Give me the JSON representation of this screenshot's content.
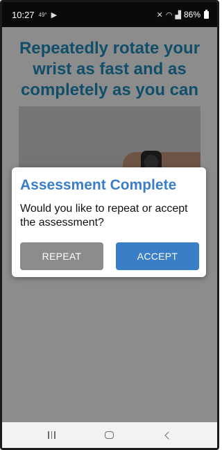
{
  "status_bar": {
    "time": "10:27",
    "notification_small": "49°",
    "battery_percent": "86%",
    "icons": [
      "play-icon",
      "mute-icon",
      "wifi-icon",
      "signal-icon",
      "battery-icon"
    ]
  },
  "screen": {
    "instruction": "Repeatedly rotate your wrist as fast and as completely as you can"
  },
  "dialog": {
    "title": "Assessment Complete",
    "message": "Would you like to repeat or accept the assessment?",
    "repeat_label": "REPEAT",
    "accept_label": "ACCEPT"
  },
  "nav_bar": {
    "icons": [
      "recents-icon",
      "home-icon",
      "back-icon"
    ]
  },
  "colors": {
    "accent": "#3a7fc6",
    "instruction_text": "#1f8fbf",
    "repeat_button": "#8c8c8c"
  }
}
